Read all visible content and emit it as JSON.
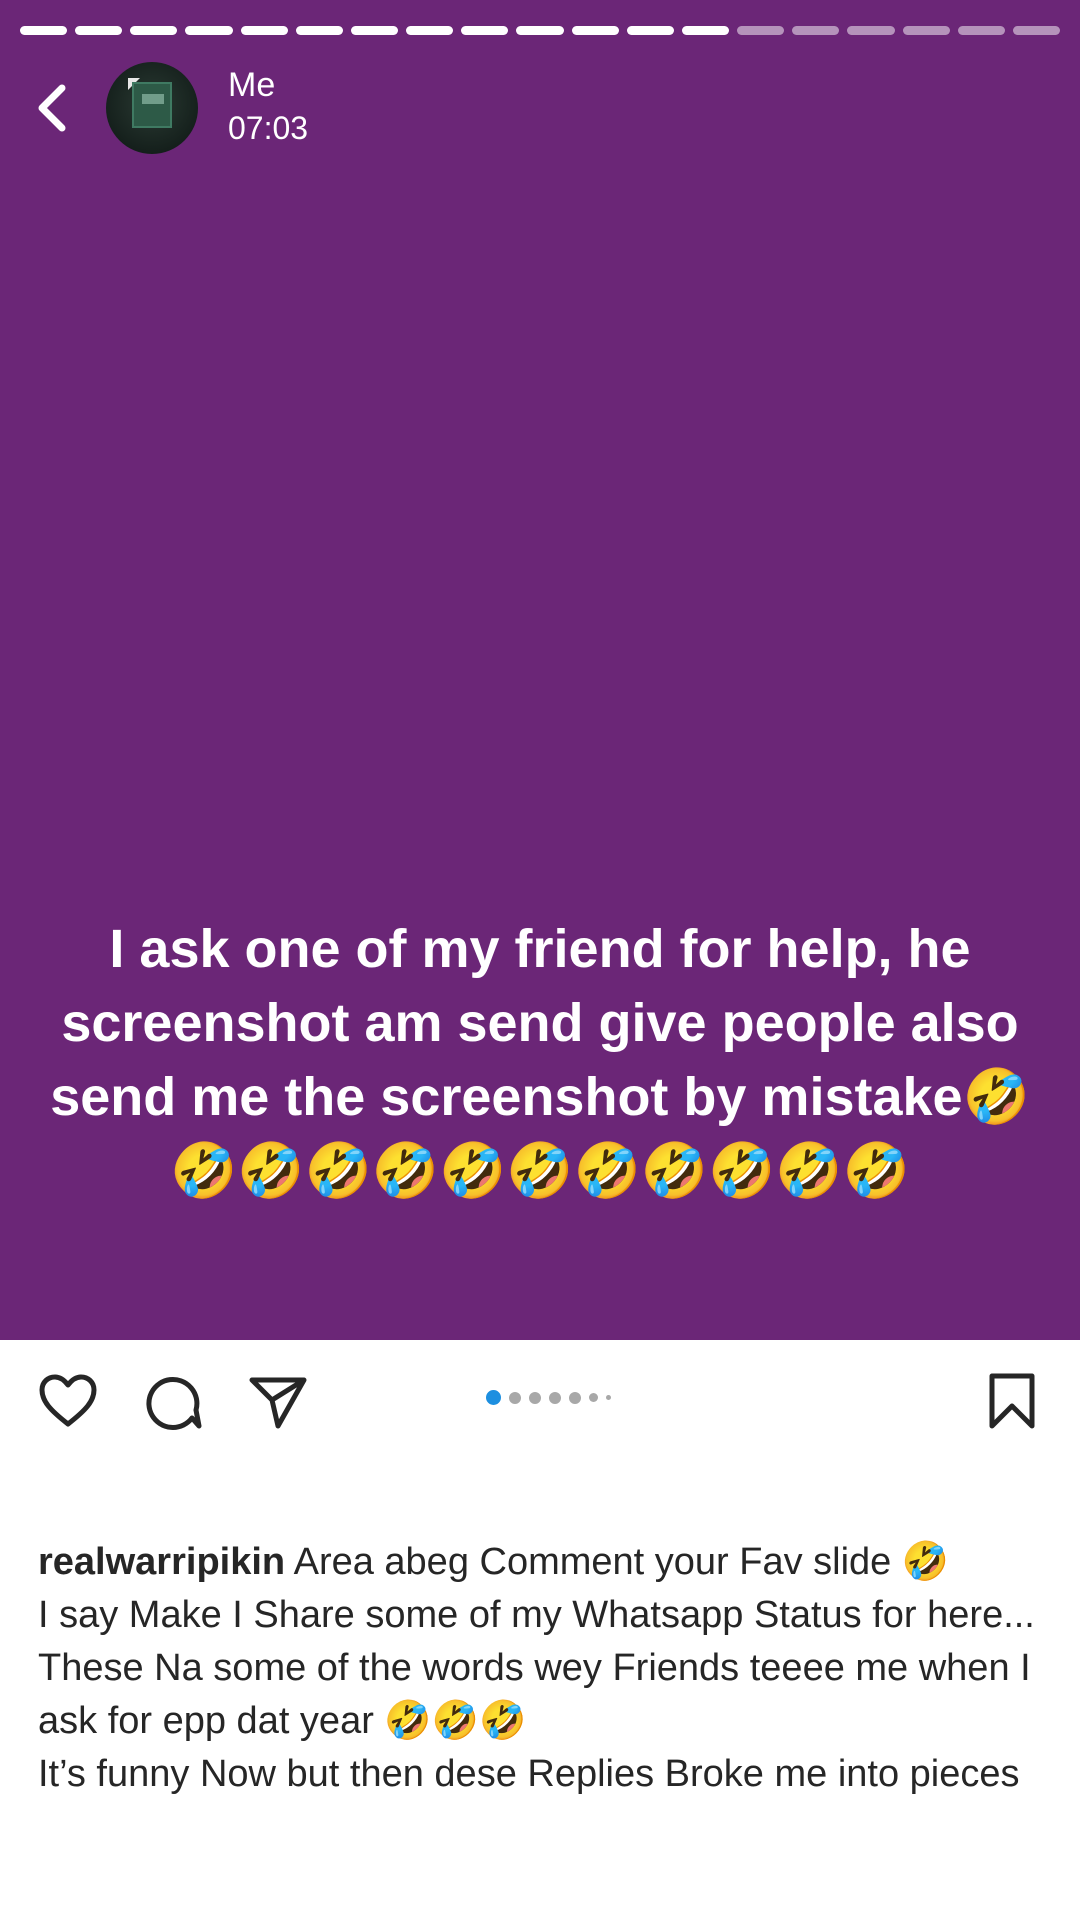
{
  "colors": {
    "story_background": "#6b2677",
    "active_dot": "#1d8fe0"
  },
  "story": {
    "progress": {
      "total_segments": 19,
      "completed_segments": 13
    },
    "author_name": "Me",
    "time": "07:03",
    "avatar_icon": "avatar-image",
    "text": "I ask one of my friend for help, he screenshot am send give people also send me the screenshot by mistake🤣🤣🤣🤣🤣🤣🤣🤣🤣🤣🤣🤣"
  },
  "actions": {
    "like_icon": "heart-icon",
    "comment_icon": "comment-icon",
    "share_icon": "send-icon",
    "save_icon": "bookmark-icon",
    "carousel": {
      "total_dots": 7,
      "active_index": 0
    }
  },
  "caption": {
    "username": "realwarripikin",
    "first_line": "Area abeg Comment your Fav slide 🤣",
    "lines": [
      "I say Make I Share some of my Whatsapp Status for here...",
      "These Na some of the words wey Friends teeee me when I ask for epp dat year 🤣🤣🤣",
      "It’s funny Now but then dese Replies Broke me into pieces"
    ]
  }
}
